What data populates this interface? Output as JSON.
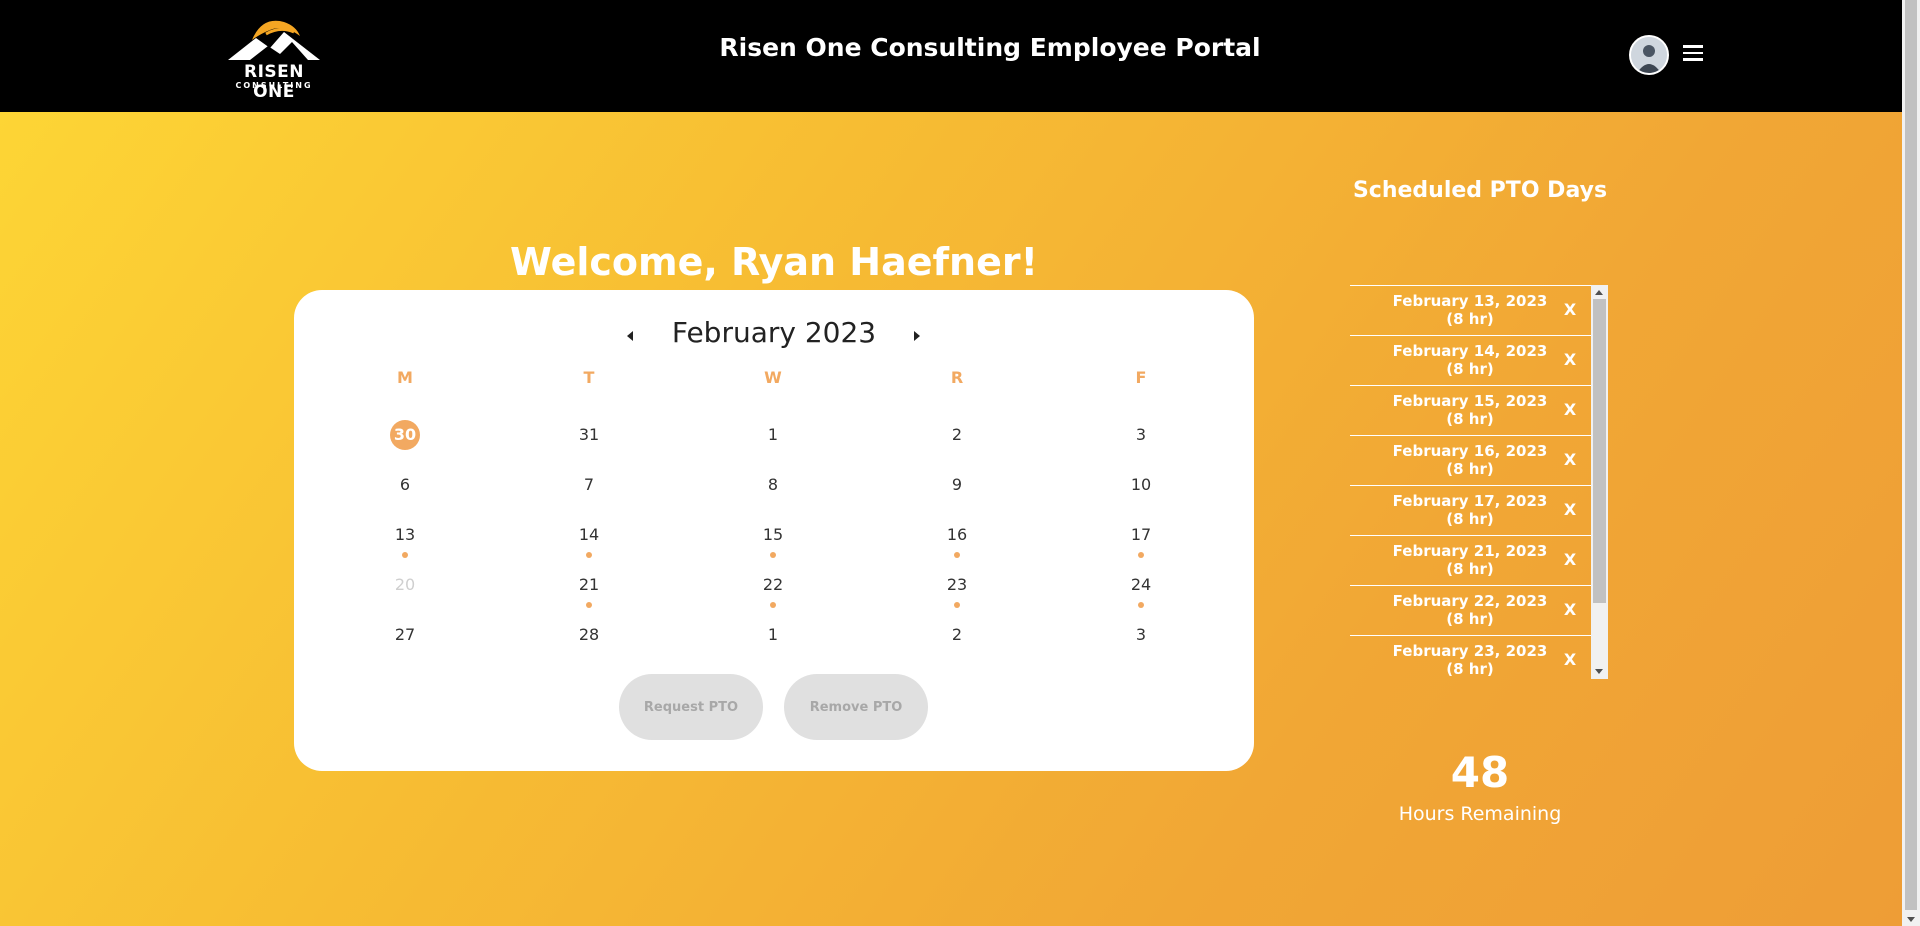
{
  "header": {
    "logo_text": "RISEN ONE",
    "logo_sub": "CONSULTING",
    "title": "Risen One Consulting Employee Portal"
  },
  "welcome": "Welcome, Ryan Haefner!",
  "calendar": {
    "month_label": "February 2023",
    "weekdays": [
      "M",
      "T",
      "W",
      "R",
      "F"
    ],
    "weeks": [
      [
        {
          "d": "30",
          "today": true
        },
        {
          "d": "31"
        },
        {
          "d": "1"
        },
        {
          "d": "2"
        },
        {
          "d": "3"
        }
      ],
      [
        {
          "d": "6"
        },
        {
          "d": "7"
        },
        {
          "d": "8"
        },
        {
          "d": "9"
        },
        {
          "d": "10"
        }
      ],
      [
        {
          "d": "13",
          "pto": true
        },
        {
          "d": "14",
          "pto": true
        },
        {
          "d": "15",
          "pto": true
        },
        {
          "d": "16",
          "pto": true
        },
        {
          "d": "17",
          "pto": true
        }
      ],
      [
        {
          "d": "20",
          "muted": true
        },
        {
          "d": "21",
          "pto": true
        },
        {
          "d": "22",
          "pto": true
        },
        {
          "d": "23",
          "pto": true
        },
        {
          "d": "24",
          "pto": true
        }
      ],
      [
        {
          "d": "27"
        },
        {
          "d": "28"
        },
        {
          "d": "1"
        },
        {
          "d": "2"
        },
        {
          "d": "3"
        }
      ]
    ],
    "request_label": "Request PTO",
    "remove_label": "Remove PTO"
  },
  "pto": {
    "heading": "Scheduled PTO Days",
    "remove_symbol": "X",
    "items": [
      {
        "date": "February 13, 2023",
        "hours": "(8 hr)"
      },
      {
        "date": "February 14, 2023",
        "hours": "(8 hr)"
      },
      {
        "date": "February 15, 2023",
        "hours": "(8 hr)"
      },
      {
        "date": "February 16, 2023",
        "hours": "(8 hr)"
      },
      {
        "date": "February 17, 2023",
        "hours": "(8 hr)"
      },
      {
        "date": "February 21, 2023",
        "hours": "(8 hr)"
      },
      {
        "date": "February 22, 2023",
        "hours": "(8 hr)"
      },
      {
        "date": "February 23, 2023",
        "hours": "(8 hr)"
      }
    ],
    "hours_remaining": "48",
    "hours_label": "Hours Remaining"
  },
  "colors": {
    "accent": "#f2a961",
    "header_bg": "#000000",
    "gradient_start": "#fdd535",
    "gradient_end": "#ee9d36"
  },
  "icons": {
    "logo": "mountain-sunrise-logo",
    "avatar": "user-avatar",
    "menu": "hamburger-menu-icon",
    "prev": "caret-left-icon",
    "next": "caret-right-icon"
  }
}
